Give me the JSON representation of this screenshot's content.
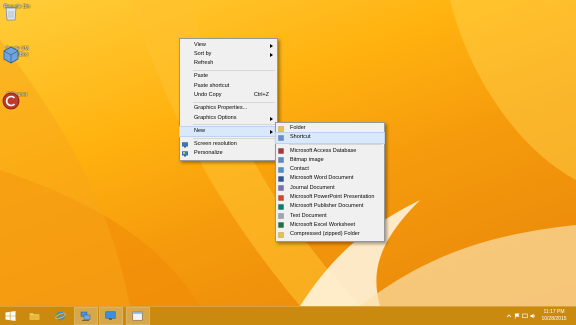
{
  "desktop": {
    "icons": [
      {
        "label": "Recycle Bin",
        "icon": "recycle-bin-icon"
      },
      {
        "label": "Oracle VM VirtualBox",
        "icon": "virtualbox-icon"
      },
      {
        "label": "CCleaner",
        "icon": "ccleaner-icon"
      }
    ]
  },
  "context_menu": {
    "items": {
      "view": "View",
      "sort_by": "Sort by",
      "refresh": "Refresh",
      "paste": "Paste",
      "paste_shortcut": "Paste shortcut",
      "undo_copy": "Undo Copy",
      "undo_copy_key": "Ctrl+Z",
      "graphics_properties": "Graphics Properties...",
      "graphics_options": "Graphics Options",
      "new": "New",
      "screen_resolution": "Screen resolution",
      "personalize": "Personalize"
    }
  },
  "new_submenu": {
    "items": [
      {
        "label": "Folder",
        "icon": "folder-icon",
        "color": "#e8c04a"
      },
      {
        "label": "Shortcut",
        "icon": "shortcut-icon",
        "color": "#6a8fc8"
      },
      {
        "label": "Microsoft Access Database",
        "icon": "access-icon",
        "color": "#a4373a"
      },
      {
        "label": "Bitmap image",
        "icon": "bitmap-icon",
        "color": "#5b8ac6"
      },
      {
        "label": "Contact",
        "icon": "contact-icon",
        "color": "#4f8fcf"
      },
      {
        "label": "Microsoft Word Document",
        "icon": "word-icon",
        "color": "#2b5797"
      },
      {
        "label": "Journal Document",
        "icon": "journal-icon",
        "color": "#7a6fb0"
      },
      {
        "label": "Microsoft PowerPoint Presentation",
        "icon": "powerpoint-icon",
        "color": "#d24726"
      },
      {
        "label": "Microsoft Publisher Document",
        "icon": "publisher-icon",
        "color": "#0e7a72"
      },
      {
        "label": "Text Document",
        "icon": "text-document-icon",
        "color": "#9aa6b2"
      },
      {
        "label": "Microsoft Excel Worksheet",
        "icon": "excel-icon",
        "color": "#1e7145"
      },
      {
        "label": "Compressed (zipped) Folder",
        "icon": "zip-folder-icon",
        "color": "#e8c04a"
      }
    ],
    "highlighted": "Shortcut"
  },
  "taskbar": {
    "buttons": [
      {
        "name": "start-button",
        "icon": "windows-logo-icon"
      },
      {
        "name": "file-explorer-button",
        "icon": "folder-icon"
      },
      {
        "name": "internet-explorer-button",
        "icon": "internet-explorer-icon"
      },
      {
        "name": "network-button",
        "icon": "network-icon"
      },
      {
        "name": "remote-desktop-button",
        "icon": "monitor-icon"
      },
      {
        "name": "window-button",
        "icon": "window-icon"
      }
    ],
    "clock": {
      "time": "11:17 PM",
      "date": "10/28/2015"
    }
  },
  "colors": {
    "desktop_orange": "#f5a10f",
    "taskbar": "#c98a0f",
    "menu_bg": "#f0f0f0",
    "highlight": "#d9e8fb"
  }
}
